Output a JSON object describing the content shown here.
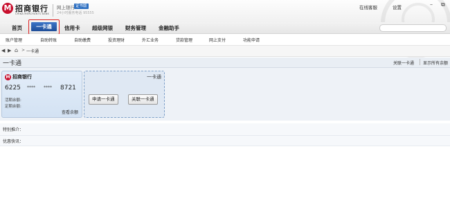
{
  "header": {
    "logo_mark": "M",
    "bank_name": "招商银行",
    "bank_name_en": "CHINA MERCHANTS BANK",
    "subtitle": "网上银行",
    "cert_badge": "证书版",
    "hotline": "24小时服务电话 95555",
    "online_cs": "在线客服",
    "settings": "设置",
    "min_glyph": "–",
    "restore_glyph": "⧉"
  },
  "main_nav": {
    "home": "首页",
    "yikatong": "一卡通",
    "credit_card": "信用卡",
    "super_bank": "超级网银",
    "wealth": "财务管理",
    "finance_helper": "金融助手"
  },
  "sub_nav": [
    "账户管理",
    "自助转账",
    "自助缴费",
    "投资理财",
    "外汇业务",
    "贷款管理",
    "网上支付",
    "功能申请"
  ],
  "breadcrumb": {
    "back_glyph": "◀",
    "forward_glyph": "▶",
    "home_glyph": "⌂",
    "sep": ">",
    "current": "一卡通"
  },
  "section": {
    "title": "一卡通",
    "link_associate": "关联一卡通",
    "link_show_all": "显示所有余额"
  },
  "card": {
    "bank_name": "招商银行",
    "num1": "6225",
    "stars1": "****",
    "stars2": "****",
    "num4": "8721",
    "current_balance_label": "活期余额:",
    "fixed_balance_label": "定期余额:",
    "query_balance": "查看余额"
  },
  "add_card": {
    "title": "一卡通",
    "apply_button": "申请一卡通",
    "associate_button": "关联一卡通"
  },
  "info": {
    "recommend": "特别推介：",
    "promotion": "优惠快讯："
  }
}
